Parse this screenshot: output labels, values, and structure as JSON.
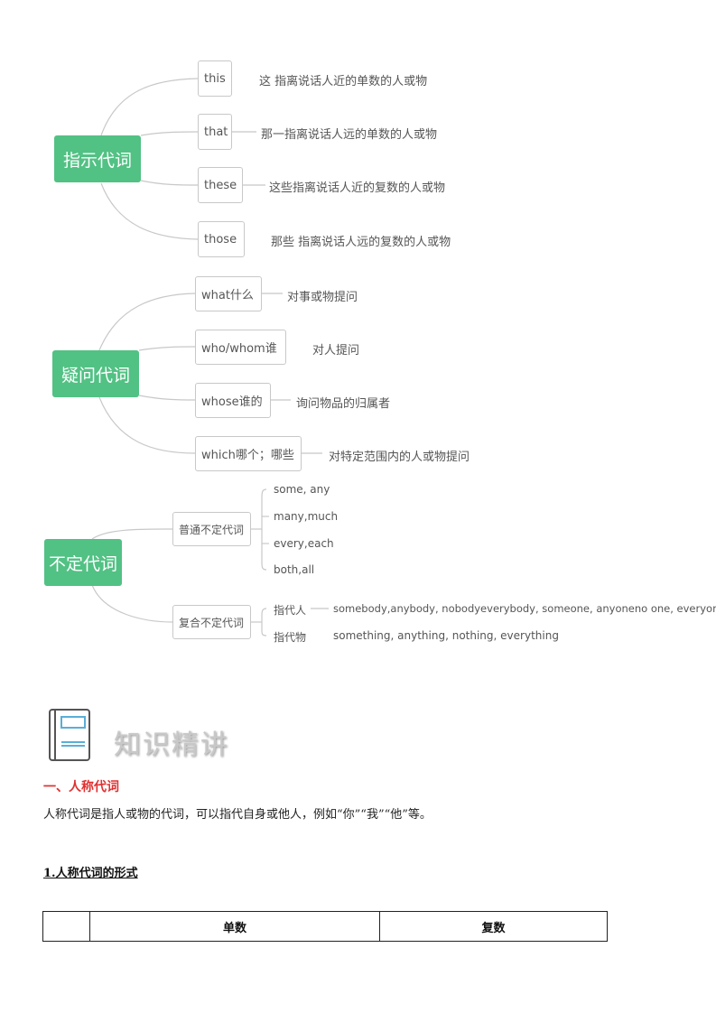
{
  "mindmap": {
    "demonstrative": {
      "label": "指示代词",
      "items": [
        {
          "word": "this",
          "desc": "这   指离说话人近的单数的人或物"
        },
        {
          "word": "that",
          "desc": "那一指离说话人远的单数的人或物"
        },
        {
          "word": "these",
          "desc": "这些指离说话人近的复数的人或物"
        },
        {
          "word": "those",
          "desc": "那些   指离说话人远的复数的人或物"
        }
      ]
    },
    "interrogative": {
      "label": "疑问代词",
      "items": [
        {
          "word": "what什么",
          "desc": "对事或物提问"
        },
        {
          "word": "who/whom谁",
          "desc": "对人提问"
        },
        {
          "word": "whose谁的",
          "desc": "询问物品的归属者"
        },
        {
          "word": "which哪个；哪些",
          "desc": "对特定范围内的人或物提问"
        }
      ]
    },
    "indefinite": {
      "label": "不定代词",
      "common": {
        "label": "普通不定代词",
        "items": [
          "some, any",
          "many,much",
          "every,each",
          "both,all"
        ]
      },
      "compound": {
        "label": "复合不定代词",
        "rows": [
          {
            "key": "指代人",
            "value": "somebody,anybody, nobodyeverybody, someone, anyoneno one, everyone"
          },
          {
            "key": "指代物",
            "value": "something, anything, nothing,  everything"
          }
        ]
      }
    }
  },
  "section": {
    "title": "知识精讲",
    "heading": "一、人称代词",
    "paragraph": "人称代词是指人或物的代词，可以指代自身或他人，例如“你”“我”“他”等。",
    "subheading": "1.人称代词的形式"
  },
  "table": {
    "headers": [
      "",
      "单数",
      "复数"
    ]
  },
  "colors": {
    "root_green": "#52c184",
    "heading_red": "#e03030",
    "logo_teal": "#5aaed6"
  }
}
